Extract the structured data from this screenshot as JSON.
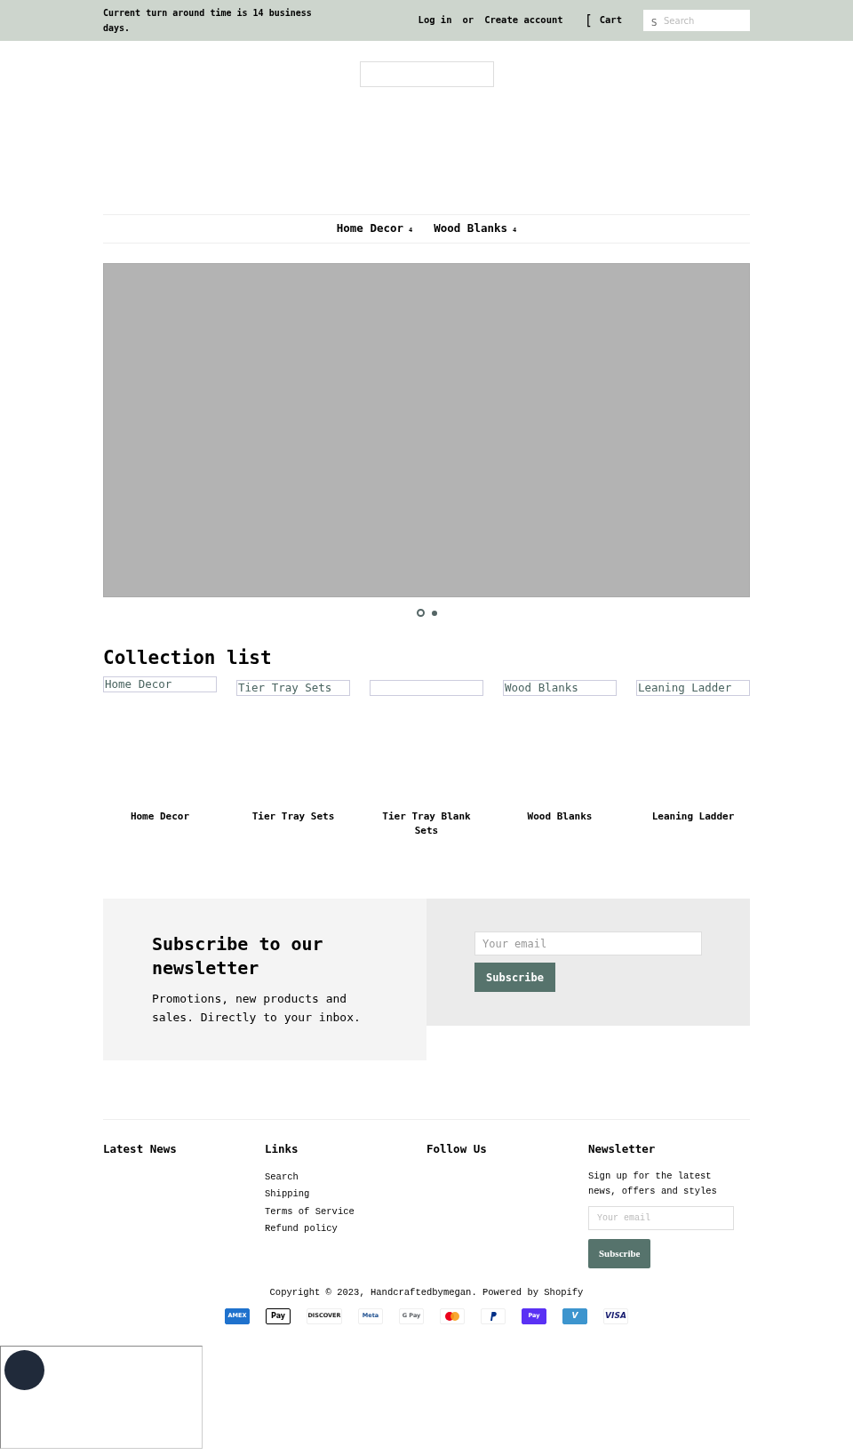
{
  "announcement": {
    "text": "Current turn around time is 14 business days."
  },
  "header_links": [
    {
      "label": "Log in",
      "kind": "link"
    },
    {
      "label": "or",
      "kind": "text"
    },
    {
      "label": "Create account",
      "kind": "link"
    }
  ],
  "cart": {
    "icon_glyph": "[",
    "label": "Cart"
  },
  "search": {
    "icon_glyph": "S",
    "placeholder": "Search"
  },
  "nav": [
    {
      "label": "Home Decor",
      "caret": "4"
    },
    {
      "label": "Wood Blanks",
      "caret": "4"
    }
  ],
  "slideshow": {
    "dots": [
      {
        "selected": true
      },
      {
        "selected": false
      }
    ]
  },
  "collection_list": {
    "title": "Collection list",
    "items": [
      {
        "image_alt": "Home Decor",
        "title": "Home Decor"
      },
      {
        "image_alt": "Tier Tray Sets",
        "title": "Tier Tray Sets"
      },
      {
        "title": "Tier Tray Blank Sets"
      },
      {
        "image_alt": "Wood Blanks",
        "title": "Wood Blanks"
      },
      {
        "image_alt": "Leaning Ladder",
        "title": "Leaning Ladder"
      }
    ]
  },
  "newsletter_section": {
    "title": "Subscribe to our newsletter",
    "text": "Promotions, new products and sales. Directly to your inbox.",
    "placeholder": "Your email",
    "button": "Subscribe"
  },
  "footer": {
    "columns": [
      {
        "title": "Latest News"
      },
      {
        "title": "Links",
        "links": [
          "Search",
          "Shipping",
          "Terms of Service",
          "Refund policy"
        ]
      },
      {
        "title": "Follow Us"
      },
      {
        "title": "Newsletter",
        "text": "Sign up for the latest news, offers and styles",
        "placeholder": "Your email",
        "button": "Subscribe"
      }
    ],
    "copyright": "Copyright © 2023, Handcraftedbymegan. Powered by Shopify",
    "payments": [
      {
        "kind": "amex",
        "label": "AMEX"
      },
      {
        "kind": "apple",
        "label": "Pay"
      },
      {
        "kind": "discover",
        "label": "DISCOVER"
      },
      {
        "kind": "meta",
        "label": "Meta"
      },
      {
        "kind": "google",
        "label": "G Pay"
      },
      {
        "kind": "mastercard"
      },
      {
        "kind": "paypal"
      },
      {
        "kind": "shop",
        "label": "Pay"
      },
      {
        "kind": "venmo",
        "label": "V"
      },
      {
        "kind": "visa",
        "label": "VISA"
      }
    ]
  }
}
